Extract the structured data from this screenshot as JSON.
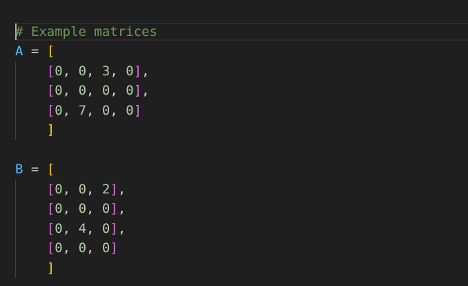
{
  "editor": {
    "comment": "# Example matrices",
    "matrices": [
      {
        "name": "A",
        "assign": " = ",
        "open": "[",
        "close": "]",
        "rows": [
          {
            "values": [
              "0",
              "0",
              "3",
              "0"
            ],
            "trailing": ","
          },
          {
            "values": [
              "0",
              "0",
              "0",
              "0"
            ],
            "trailing": ","
          },
          {
            "values": [
              "0",
              "7",
              "0",
              "0"
            ],
            "trailing": ""
          }
        ]
      },
      {
        "name": "B",
        "assign": " = ",
        "open": "[",
        "close": "]",
        "rows": [
          {
            "values": [
              "0",
              "0",
              "2"
            ],
            "trailing": ","
          },
          {
            "values": [
              "0",
              "0",
              "0"
            ],
            "trailing": ","
          },
          {
            "values": [
              "0",
              "4",
              "0"
            ],
            "trailing": ","
          },
          {
            "values": [
              "0",
              "0",
              "0"
            ],
            "trailing": ""
          }
        ]
      }
    ],
    "colors": {
      "background": "#1f1f1f",
      "comment": "#6a9955",
      "variable": "#4fc1ff",
      "bracket_outer": "#ffd700",
      "bracket_inner": "#da70d6",
      "number": "#b5cea8"
    }
  }
}
